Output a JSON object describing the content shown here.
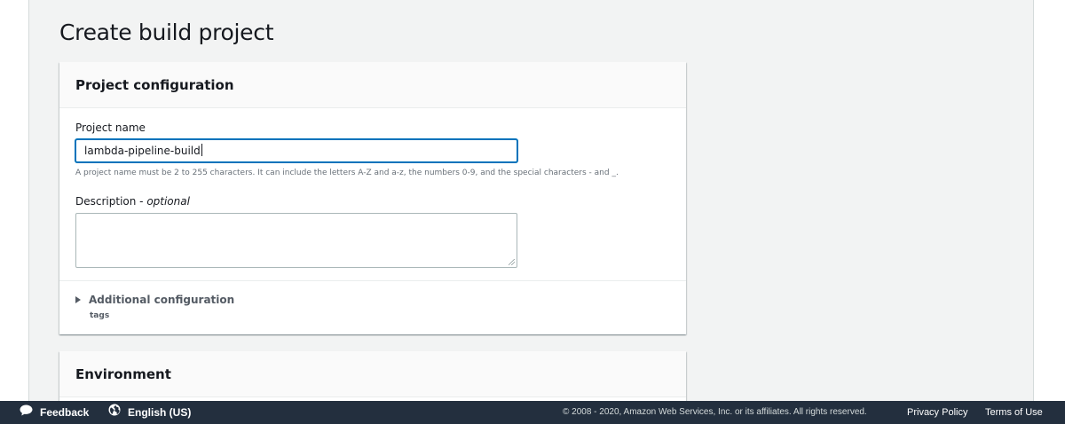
{
  "page": {
    "title": "Create build project"
  },
  "project_config": {
    "header": "Project configuration",
    "project_name_label": "Project name",
    "project_name_value": "lambda-pipeline-build",
    "project_name_hint": "A project name must be 2 to 255 characters. It can include the letters A-Z and a-z, the numbers 0-9, and the special characters - and _.",
    "description_label": "Description - ",
    "description_optional": "optional",
    "description_value": "",
    "additional_config_label": "Additional configuration",
    "additional_config_sub": "tags"
  },
  "environment": {
    "header": "Environment"
  },
  "footer": {
    "feedback": "Feedback",
    "language": "English (US)",
    "copyright": "© 2008 - 2020, Amazon Web Services, Inc. or its affiliates. All rights reserved.",
    "privacy": "Privacy Policy",
    "terms": "Terms of Use",
    "icons": [
      "speech-bubble-icon",
      "globe-icon"
    ]
  }
}
